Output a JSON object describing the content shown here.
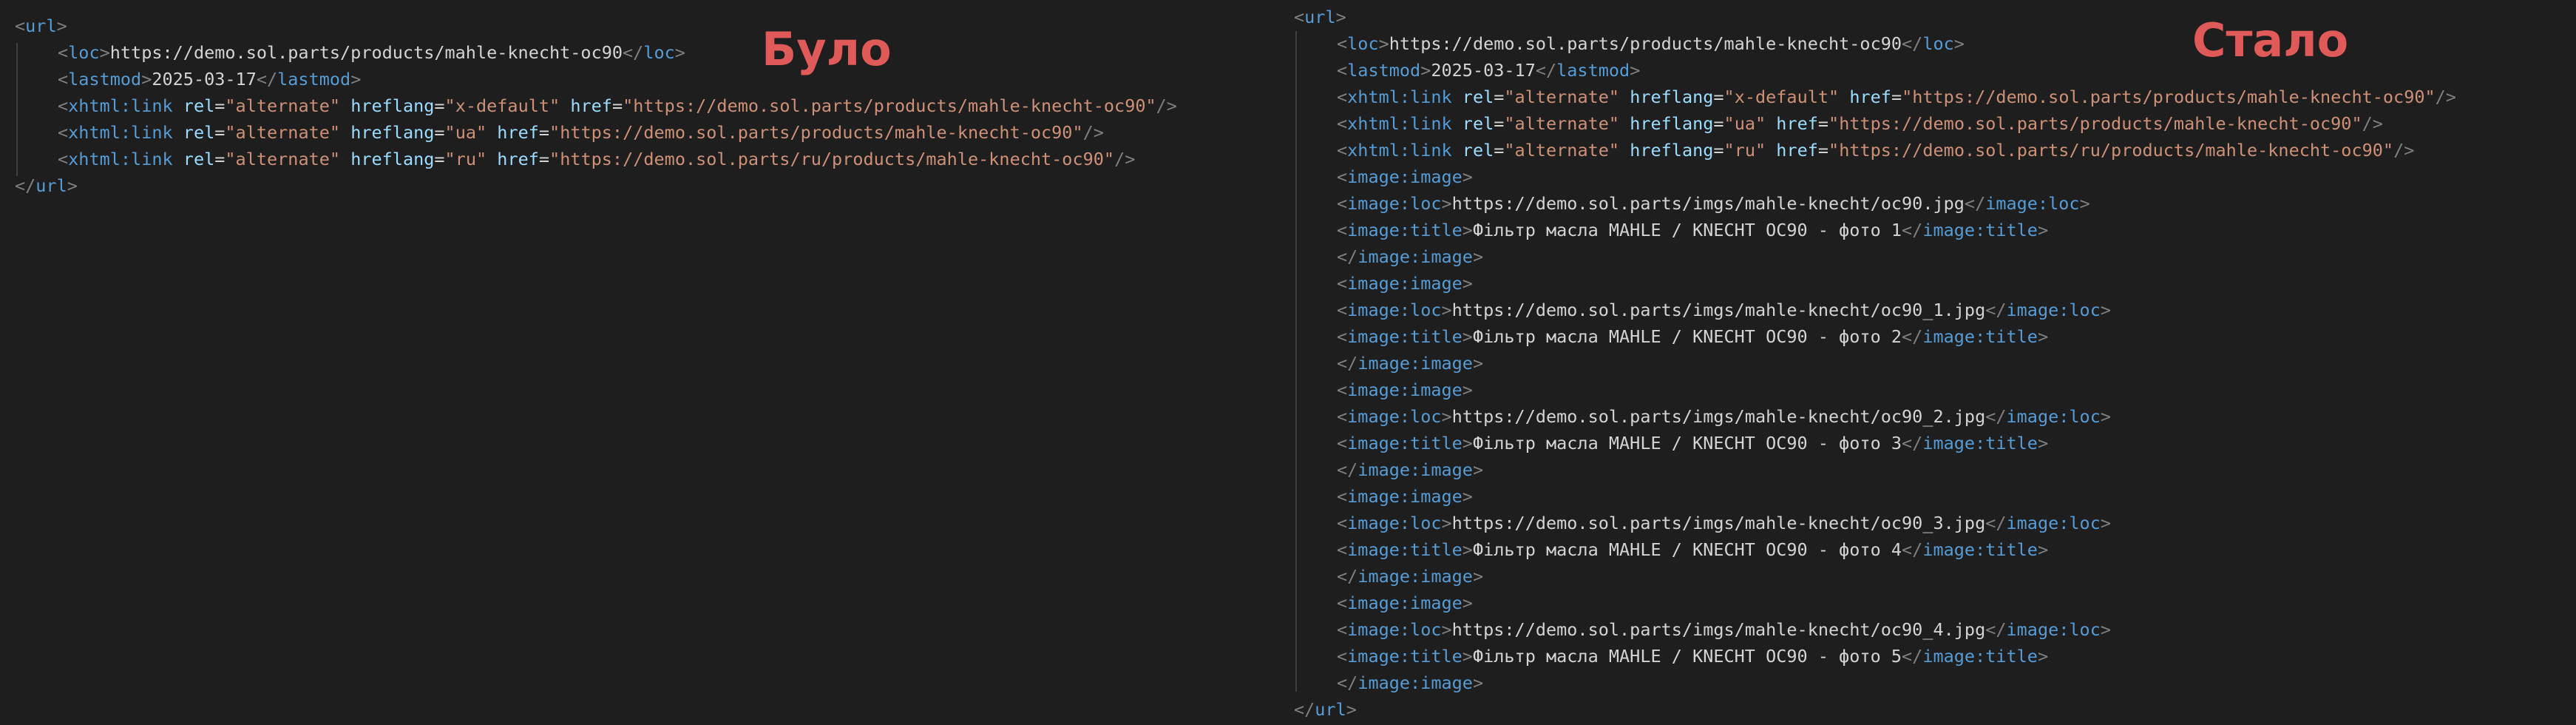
{
  "colors": {
    "background": "#1e1e1e",
    "label": "#e05a5a",
    "tag": "#569cd6",
    "bracket": "#808080",
    "attribute": "#9cdcfe",
    "value": "#ce9178",
    "text": "#d4d4d4"
  },
  "tags": {
    "url": "url",
    "loc": "loc",
    "lastmod": "lastmod",
    "xhtml_link": "xhtml:link",
    "image_image": "image:image",
    "image_loc": "image:loc",
    "image_title": "image:title"
  },
  "attr_names": {
    "rel": "rel",
    "hreflang": "hreflang",
    "href": "href"
  },
  "before": {
    "label": "Було",
    "loc": "https://demo.sol.parts/products/mahle-knecht-oc90",
    "lastmod": "2025-03-17",
    "links": [
      {
        "rel": "\"alternate\"",
        "hreflang": "\"x-default\"",
        "href": "\"https://demo.sol.parts/products/mahle-knecht-oc90\""
      },
      {
        "rel": "\"alternate\"",
        "hreflang": "\"ua\"",
        "href": "\"https://demo.sol.parts/products/mahle-knecht-oc90\""
      },
      {
        "rel": "\"alternate\"",
        "hreflang": "\"ru\"",
        "href": "\"https://demo.sol.parts/ru/products/mahle-knecht-oc90\""
      }
    ]
  },
  "after": {
    "label": "Стало",
    "loc": "https://demo.sol.parts/products/mahle-knecht-oc90",
    "lastmod": "2025-03-17",
    "links": [
      {
        "rel": "\"alternate\"",
        "hreflang": "\"x-default\"",
        "href": "\"https://demo.sol.parts/products/mahle-knecht-oc90\""
      },
      {
        "rel": "\"alternate\"",
        "hreflang": "\"ua\"",
        "href": "\"https://demo.sol.parts/products/mahle-knecht-oc90\""
      },
      {
        "rel": "\"alternate\"",
        "hreflang": "\"ru\"",
        "href": "\"https://demo.sol.parts/ru/products/mahle-knecht-oc90\""
      }
    ],
    "images": [
      {
        "loc": "https://demo.sol.parts/imgs/mahle-knecht/oc90.jpg",
        "title": "Фільтр масла MAHLE / KNECHT OC90 - фото 1"
      },
      {
        "loc": "https://demo.sol.parts/imgs/mahle-knecht/oc90_1.jpg",
        "title": "Фільтр масла MAHLE / KNECHT OC90 - фото 2"
      },
      {
        "loc": "https://demo.sol.parts/imgs/mahle-knecht/oc90_2.jpg",
        "title": "Фільтр масла MAHLE / KNECHT OC90 - фото 3"
      },
      {
        "loc": "https://demo.sol.parts/imgs/mahle-knecht/oc90_3.jpg",
        "title": "Фільтр масла MAHLE / KNECHT OC90 - фото 4"
      },
      {
        "loc": "https://demo.sol.parts/imgs/mahle-knecht/oc90_4.jpg",
        "title": "Фільтр масла MAHLE / KNECHT OC90 - фото 5"
      }
    ]
  }
}
